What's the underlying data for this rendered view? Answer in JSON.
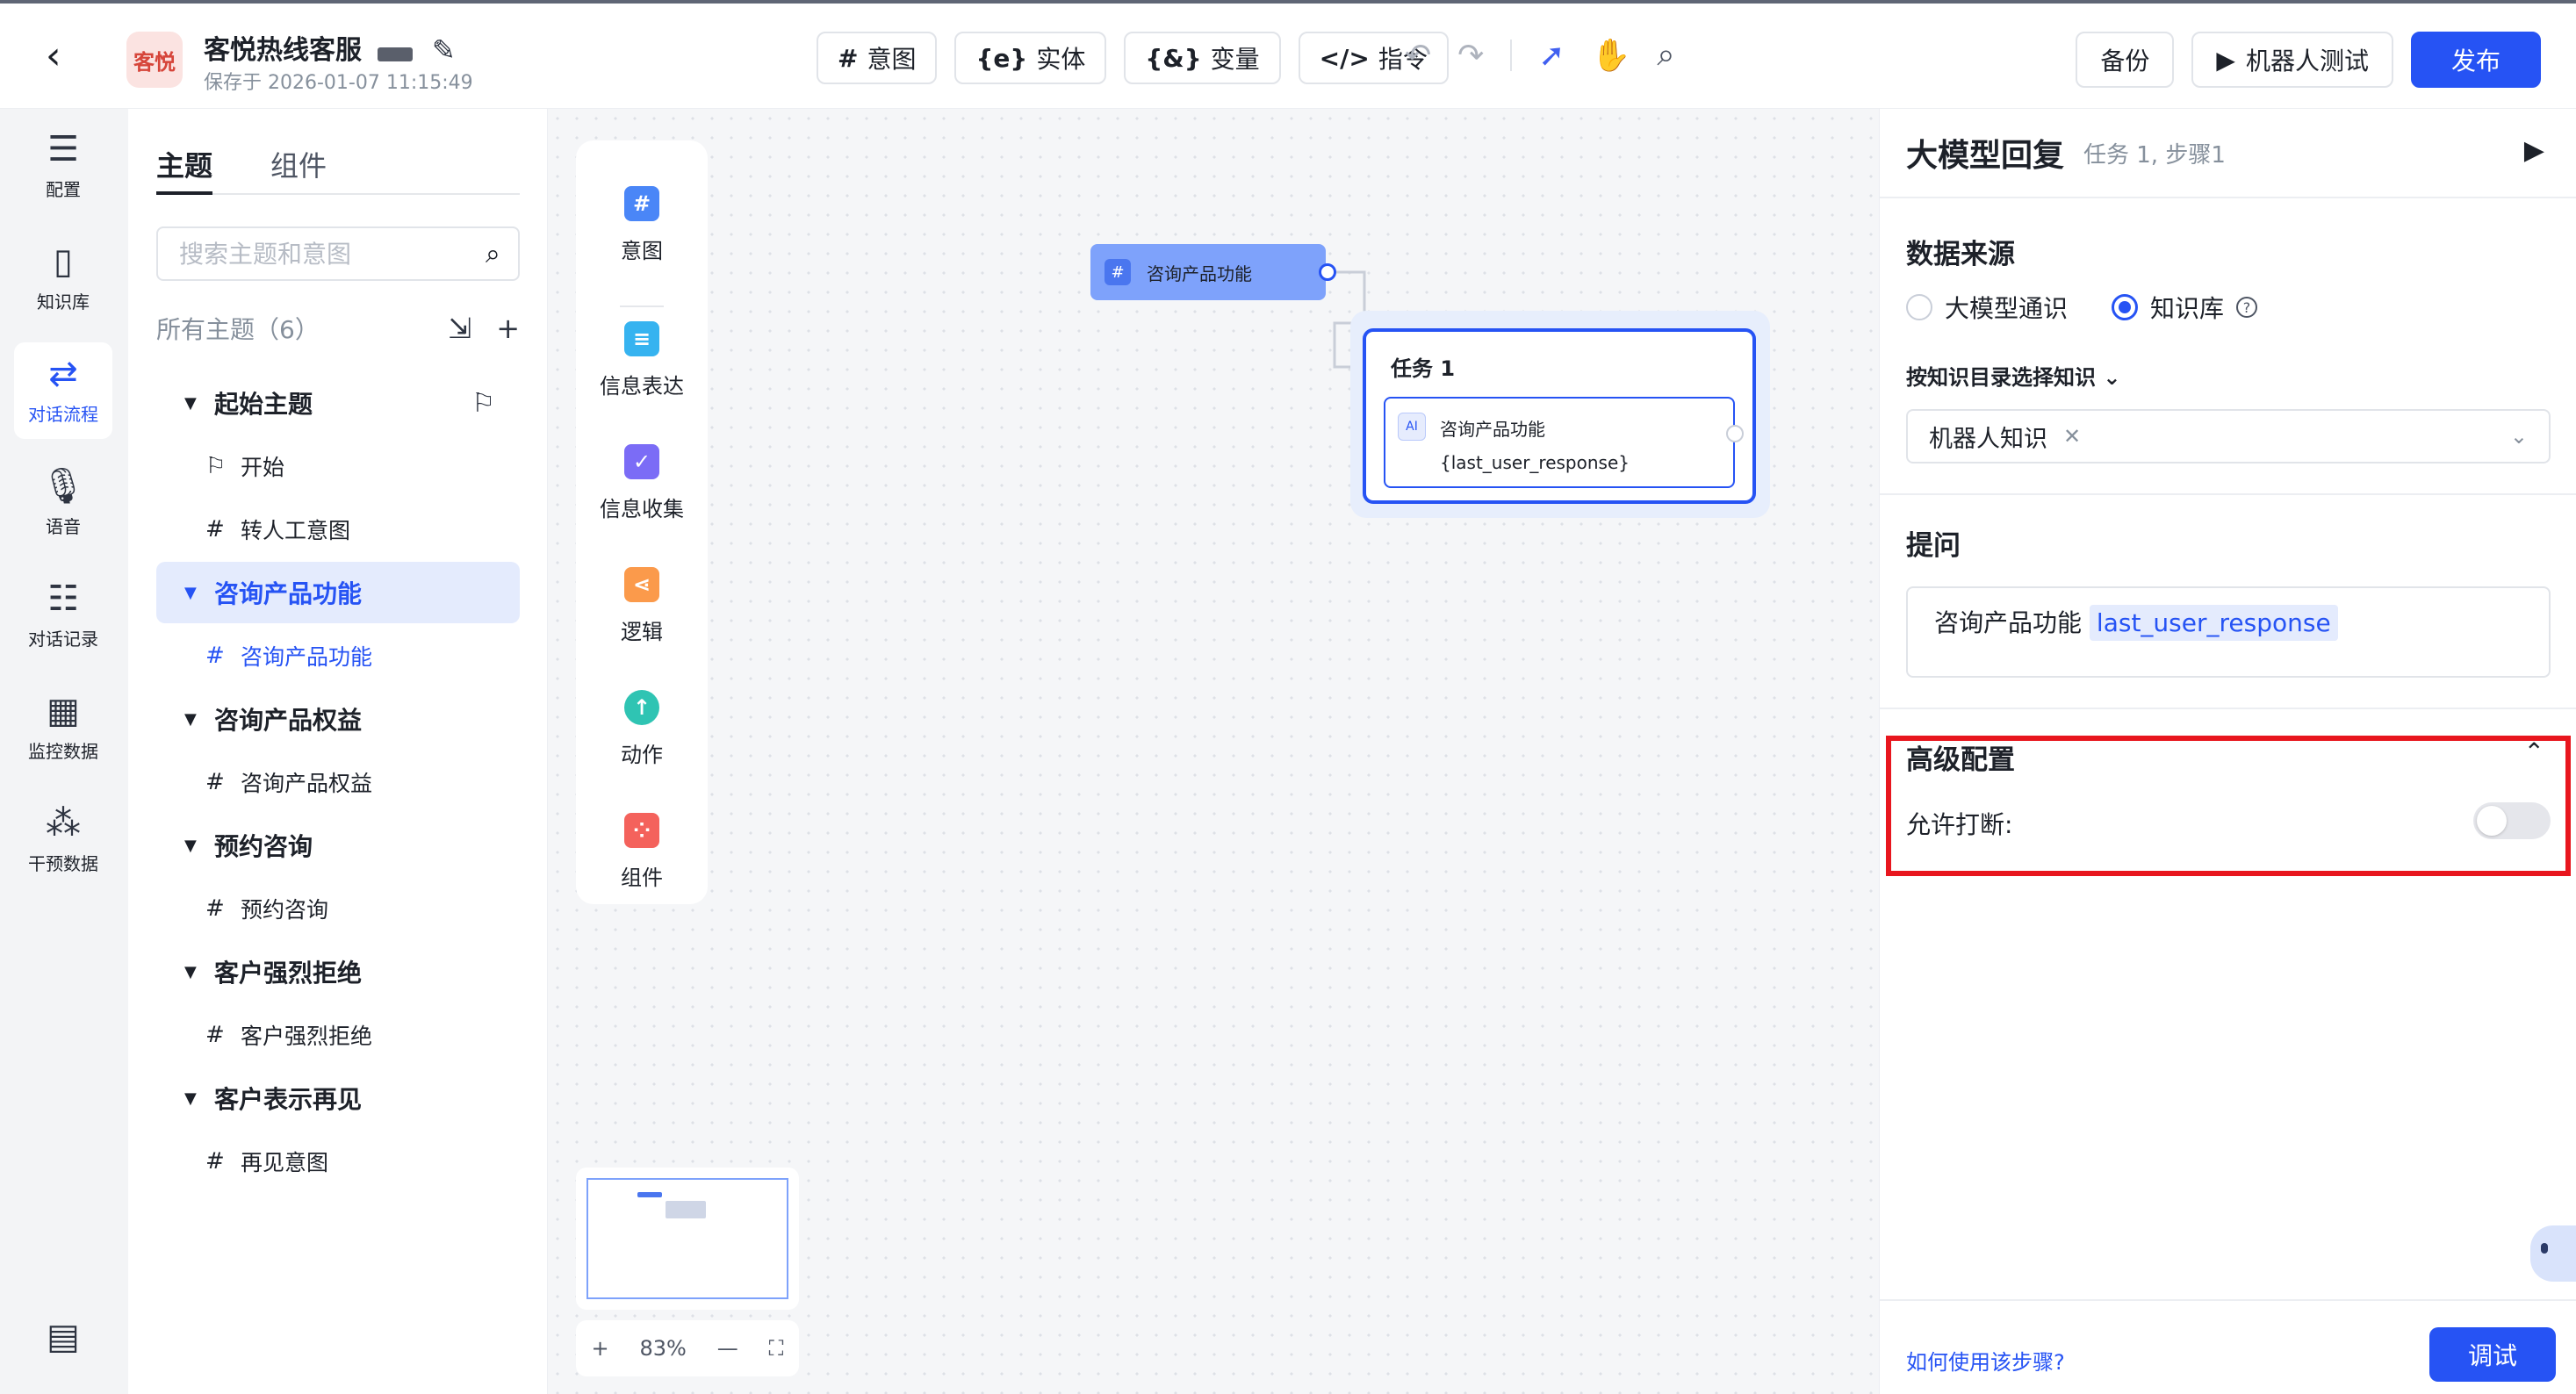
{
  "header": {
    "app_logo_text": "客悦",
    "app_title": "客悦热线客服",
    "save_time": "保存于 2026-01-07 11:15:49",
    "tools": [
      {
        "icon": "#",
        "label": "意图"
      },
      {
        "icon": "{e}",
        "label": "实体"
      },
      {
        "icon": "{&}",
        "label": "变量"
      },
      {
        "icon": "</>",
        "label": "指令"
      }
    ],
    "backup_label": "备份",
    "robot_test_label": "机器人测试",
    "publish_label": "发布"
  },
  "rail": {
    "items": [
      {
        "label": "配置",
        "icon": "sliders-icon"
      },
      {
        "label": "知识库",
        "icon": "book-icon"
      },
      {
        "label": "对话流程",
        "icon": "flow-icon",
        "active": true
      },
      {
        "label": "语音",
        "icon": "mic-icon"
      },
      {
        "label": "对话记录",
        "icon": "chat-icon"
      },
      {
        "label": "监控数据",
        "icon": "monitor-icon"
      },
      {
        "label": "干预数据",
        "icon": "nodes-icon"
      }
    ]
  },
  "topics": {
    "tab_topic": "主题",
    "tab_component": "组件",
    "search_placeholder": "搜索主题和意图",
    "all_topics": "所有主题（6）",
    "groups": [
      {
        "name": "起始主题",
        "children": [
          {
            "icon": "⚑",
            "name": "开始"
          },
          {
            "icon": "#",
            "name": "转人工意图"
          }
        ]
      },
      {
        "name": "咨询产品功能",
        "children": [
          {
            "icon": "#",
            "name": "咨询产品功能"
          }
        ]
      },
      {
        "name": "咨询产品权益",
        "children": [
          {
            "icon": "#",
            "name": "咨询产品权益"
          }
        ]
      },
      {
        "name": "预约咨询",
        "children": [
          {
            "icon": "#",
            "name": "预约咨询"
          }
        ]
      },
      {
        "name": "客户强烈拒绝",
        "children": [
          {
            "icon": "#",
            "name": "客户强烈拒绝"
          }
        ]
      },
      {
        "name": "客户表示再见",
        "children": [
          {
            "icon": "#",
            "name": "再见意图"
          }
        ]
      }
    ]
  },
  "palette": {
    "items": [
      {
        "label": "意图",
        "color": "#4a86f7",
        "glyph": "#"
      },
      {
        "label": "信息表达",
        "color": "#36b3f0",
        "glyph": "≡"
      },
      {
        "label": "信息收集",
        "color": "#7b6cf6",
        "glyph": "✓"
      },
      {
        "label": "逻辑",
        "color": "#fb9a4b",
        "glyph": "⋖"
      },
      {
        "label": "动作",
        "color": "#2fc4b3",
        "glyph": "↑"
      },
      {
        "label": "组件",
        "color": "#f4625c",
        "glyph": "⁘"
      }
    ]
  },
  "canvas": {
    "intent_node_label": "咨询产品功能",
    "task_title": "任务 1",
    "task_step_text": "咨询产品功能{last_user_response}",
    "zoom": "83%"
  },
  "props": {
    "title": "大模型回复",
    "subtitle": "任务 1, 步骤1",
    "data_source_title": "数据来源",
    "source_options": [
      "大模型通识",
      "知识库"
    ],
    "source_selected": "知识库",
    "kdir_label": "按知识目录选择知识",
    "kselect_tag": "机器人知识",
    "question_title": "提问",
    "question_text": "咨询产品功能",
    "question_var": "last_user_response",
    "advanced_title": "高级配置",
    "interrupt_label": "允许打断:",
    "interrupt_enabled": false,
    "howto_label": "如何使用该步骤?",
    "debug_label": "调试"
  },
  "colors": {
    "accent": "#2653f4",
    "highlight": "#e8161e"
  }
}
